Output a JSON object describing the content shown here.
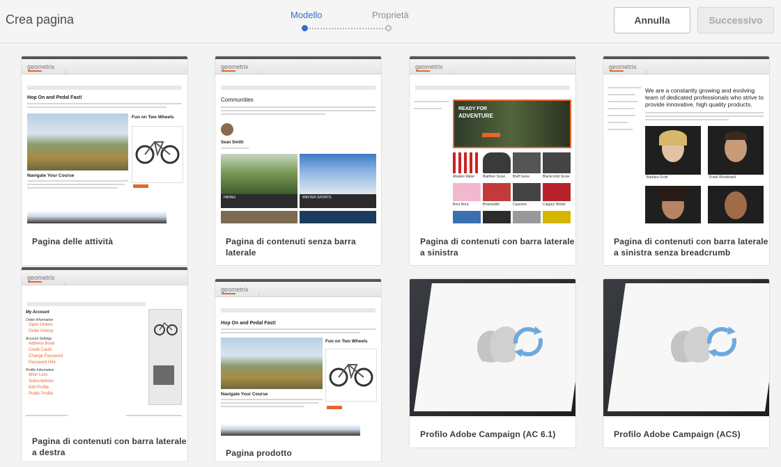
{
  "header": {
    "title": "Crea pagina",
    "steps": [
      {
        "label": "Modello",
        "state": "active"
      },
      {
        "label": "Proprietà",
        "state": "inactive"
      }
    ],
    "cancel_label": "Annulla",
    "next_label": "Successivo",
    "accent_color": "#326ec8"
  },
  "cards": [
    {
      "label": "Pagina delle attività"
    },
    {
      "label": "Pagina di contenuti senza barra laterale"
    },
    {
      "label": "Pagina di contenuti con barra laterale a sinistra"
    },
    {
      "label": "Pagina di contenuti con barra laterale a sinistra senza breadcrumb"
    },
    {
      "label": "Pagina di contenuti con barra laterale a destra"
    },
    {
      "label": "Pagina prodotto"
    },
    {
      "label": "Profilo Adobe Campaign (AC 6.1)"
    },
    {
      "label": "Profilo Adobe Campaign (ACS)"
    }
  ],
  "thumbnails": {
    "logo": "geometrix",
    "activity": {
      "heading": "Hop On and Pedal Fast!",
      "sub1": "Fun on Two Wheels",
      "sub2": "Navigate Your Course"
    },
    "nosidebar": {
      "heading": "Communities",
      "person": "Sean Smith",
      "cap1": "HIKING",
      "cap2": "WINTER SPORTS"
    },
    "leftsidebar": {
      "banner1": "READY FOR",
      "banner2": "ADVENTURE",
      "products": [
        "Abalian Water",
        "Biathlon Snow",
        "Bluff Snow",
        "Blackcomb Snow",
        "Bora Bora",
        "Brazzaville",
        "Cayenne",
        "Calgary Winter"
      ]
    },
    "nobreadcrumb": {
      "heading": "We are a constantly growing and evolving team of dedicated professionals who strive to provide innovative, high quality products.",
      "names": [
        "Barbara Scott",
        "Frank Woodward"
      ]
    },
    "rightsidebar": {
      "heading": "My Account",
      "sections": [
        "Order Information",
        "Account Settings",
        "Profile Information"
      ],
      "links": [
        "Open Orders",
        "Order History",
        "Address Book",
        "Credit Cards",
        "Change Password",
        "Password Hint",
        "Wish Lists",
        "Subscriptions",
        "Edit Profile",
        "Public Profile"
      ]
    },
    "product": {
      "heading": "Hop On and Pedal Fast!",
      "sub1": "Fun on Two Wheels",
      "sub2": "Navigate Your Course"
    }
  }
}
